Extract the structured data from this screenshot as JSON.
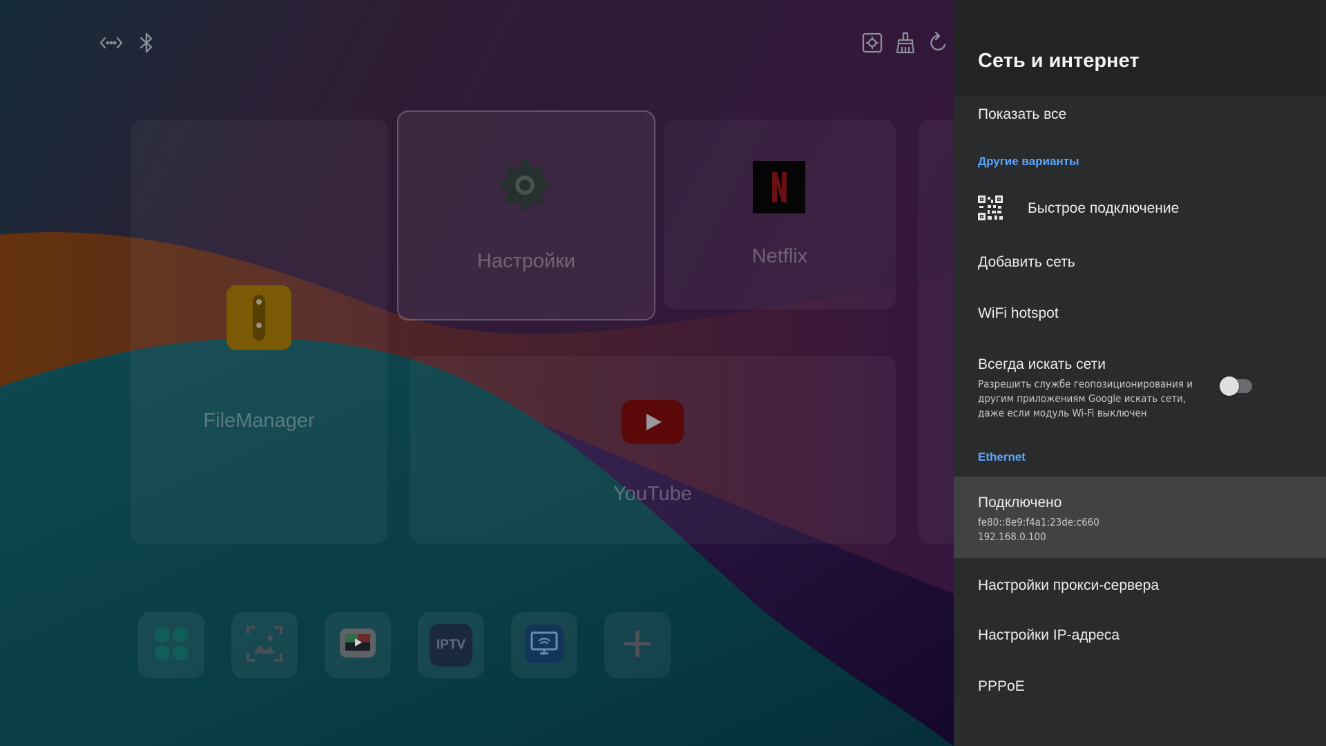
{
  "launcher": {
    "status_icons": [
      "network-arrows-icon",
      "bluetooth-icon"
    ],
    "top_icons": [
      "screenshot-icon",
      "clean-icon",
      "refresh-icon"
    ],
    "cards": [
      {
        "label": "FileManager",
        "icon": "file-manager-icon"
      },
      {
        "label": "Настройки",
        "icon": "gear-icon"
      },
      {
        "label": "Netflix",
        "icon": "netflix-icon"
      },
      {
        "label": "YouTube",
        "icon": "youtube-icon"
      }
    ],
    "dock": [
      {
        "icon": "apps-grid-icon"
      },
      {
        "icon": "gallery-icon"
      },
      {
        "icon": "media-player-icon"
      },
      {
        "icon": "iptv-icon",
        "text": "IPTV"
      },
      {
        "icon": "screen-cast-icon"
      },
      {
        "icon": "add-icon"
      }
    ]
  },
  "panel": {
    "title": "Сеть и интернет",
    "show_all": "Показать все",
    "section_other": "Другие варианты",
    "quick_connect": "Быстрое подключение",
    "add_network": "Добавить сеть",
    "wifi_hotspot": "WiFi hotspot",
    "always_scan": {
      "title": "Всегда искать сети",
      "desc_1": "Разрешить службе геопозиционирования и",
      "desc_2": "другим приложениям Google искать сети,",
      "desc_3": "даже если модуль Wi-Fi выключен",
      "enabled": false
    },
    "section_ethernet": "Ethernet",
    "connected": {
      "title": "Подключено",
      "ipv6": "fe80::8e9:f4a1:23de:c660",
      "ipv4": "192.168.0.100"
    },
    "proxy": "Настройки прокси-сервера",
    "ip_settings": "Настройки IP-адреса",
    "pppoe": "PPPoE"
  },
  "colors": {
    "panel_bg": "#2a2b2d",
    "header_bg": "#222325",
    "accent": "#5aa8ff",
    "highlight": "#414244"
  }
}
